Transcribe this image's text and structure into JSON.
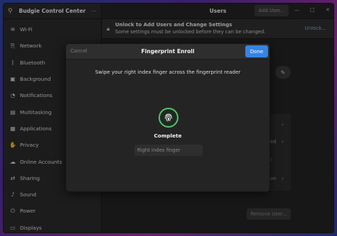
{
  "sidebar": {
    "title": "Budgie Control Center",
    "items": [
      {
        "label": "Wi-Fi",
        "icon": "wifi-icon",
        "glyph": "≋"
      },
      {
        "label": "Network",
        "icon": "network-icon",
        "glyph": "⎘"
      },
      {
        "label": "Bluetooth",
        "icon": "bluetooth-icon",
        "glyph": "ᛒ"
      },
      {
        "label": "Background",
        "icon": "background-icon",
        "glyph": "▣"
      },
      {
        "label": "Notifications",
        "icon": "bell-icon",
        "glyph": "◔"
      },
      {
        "label": "Multitasking",
        "icon": "multitasking-icon",
        "glyph": "▤"
      },
      {
        "label": "Applications",
        "icon": "applications-icon",
        "glyph": "▦"
      },
      {
        "label": "Privacy",
        "icon": "hand-icon",
        "glyph": "✋"
      },
      {
        "label": "Online Accounts",
        "icon": "cloud-icon",
        "glyph": "☁"
      },
      {
        "label": "Sharing",
        "icon": "share-icon",
        "glyph": "⇄"
      },
      {
        "label": "Sound",
        "icon": "speaker-icon",
        "glyph": "♪"
      },
      {
        "label": "Power",
        "icon": "power-icon",
        "glyph": "⏻"
      },
      {
        "label": "Displays",
        "icon": "display-icon",
        "glyph": "▭"
      }
    ]
  },
  "main": {
    "title": "Users",
    "add_user": "Add User...",
    "unlock_title": "Unlock to Add Users and Change Settings",
    "unlock_sub": "Some settings must be unlocked before they can be changed.",
    "unlock_link": "Unlock...",
    "remove_user": "Remove User...",
    "obscured_fragments": [
      "ed",
      "on"
    ]
  },
  "dialog": {
    "cancel": "Cancel",
    "title": "Fingerprint Enroll",
    "done": "Done",
    "instruction": "Swipe your right index finger across the fingerprint reader",
    "status": "Complete",
    "finger_name": "Right index finger"
  },
  "colors": {
    "accent": "#3584e4",
    "success": "#57c06f",
    "link": "#78aeed"
  }
}
